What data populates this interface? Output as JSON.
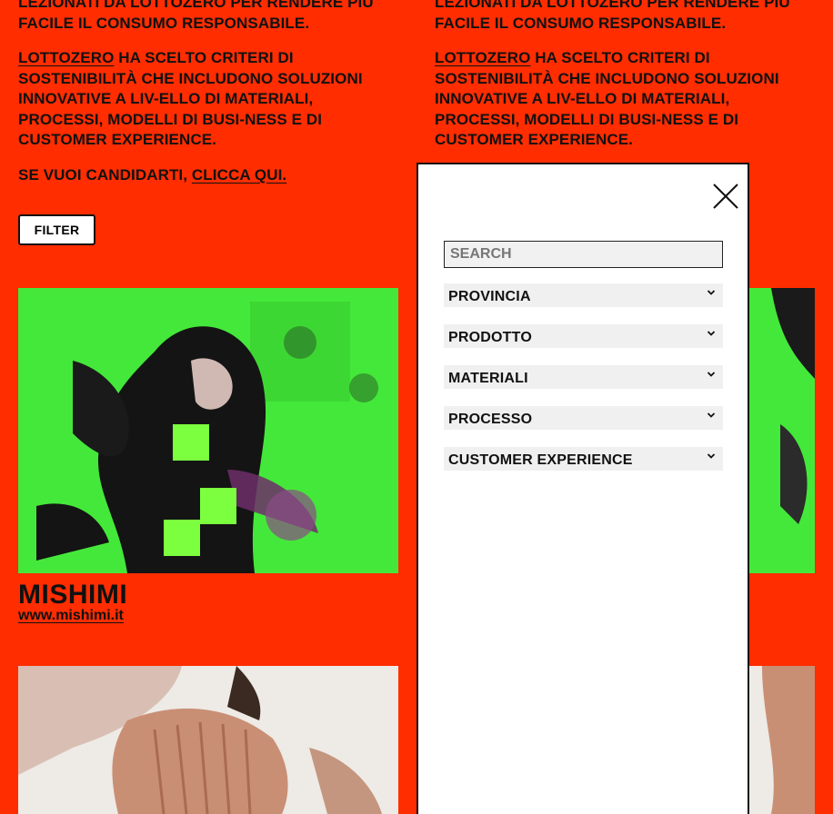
{
  "intro": {
    "line_top": "LEZIONATI DA LOTTOZERO PER RENDERE PIÙ",
    "line_top2": "FACILE IL CONSUMO RESPONSABILE.",
    "lottozero_link": "LOTTOZERO",
    "criteria_text": " HA SCELTO CRITERI DI SOSTENIBILITÀ CHE INCLUDONO SOLUZIONI INNOVATIVE A LIV-ELLO DI MATERIALI, PROCESSI, MODELLI DI BUSI-NESS E DI CUSTOMER EXPERIENCE.",
    "apply_text": "SE VUOI CANDIDARTI, ",
    "apply_link": "CLICCA QUI."
  },
  "filter_button": "FILTER",
  "card": {
    "name": "MISHIMI",
    "url": "www.mishimi.it"
  },
  "filter_panel": {
    "search_placeholder": "SEARCH",
    "dropdowns": [
      {
        "label": "PROVINCIA"
      },
      {
        "label": "PRODOTTO"
      },
      {
        "label": "MATERIALI"
      },
      {
        "label": "PROCESSO"
      },
      {
        "label": "CUSTOMER EXPERIENCE"
      }
    ]
  },
  "icons": {
    "close": "close-icon",
    "chevron": "chevron-down-icon"
  },
  "colors": {
    "background": "#ff2d00",
    "image_green": "#44e83a",
    "text": "#111111"
  }
}
